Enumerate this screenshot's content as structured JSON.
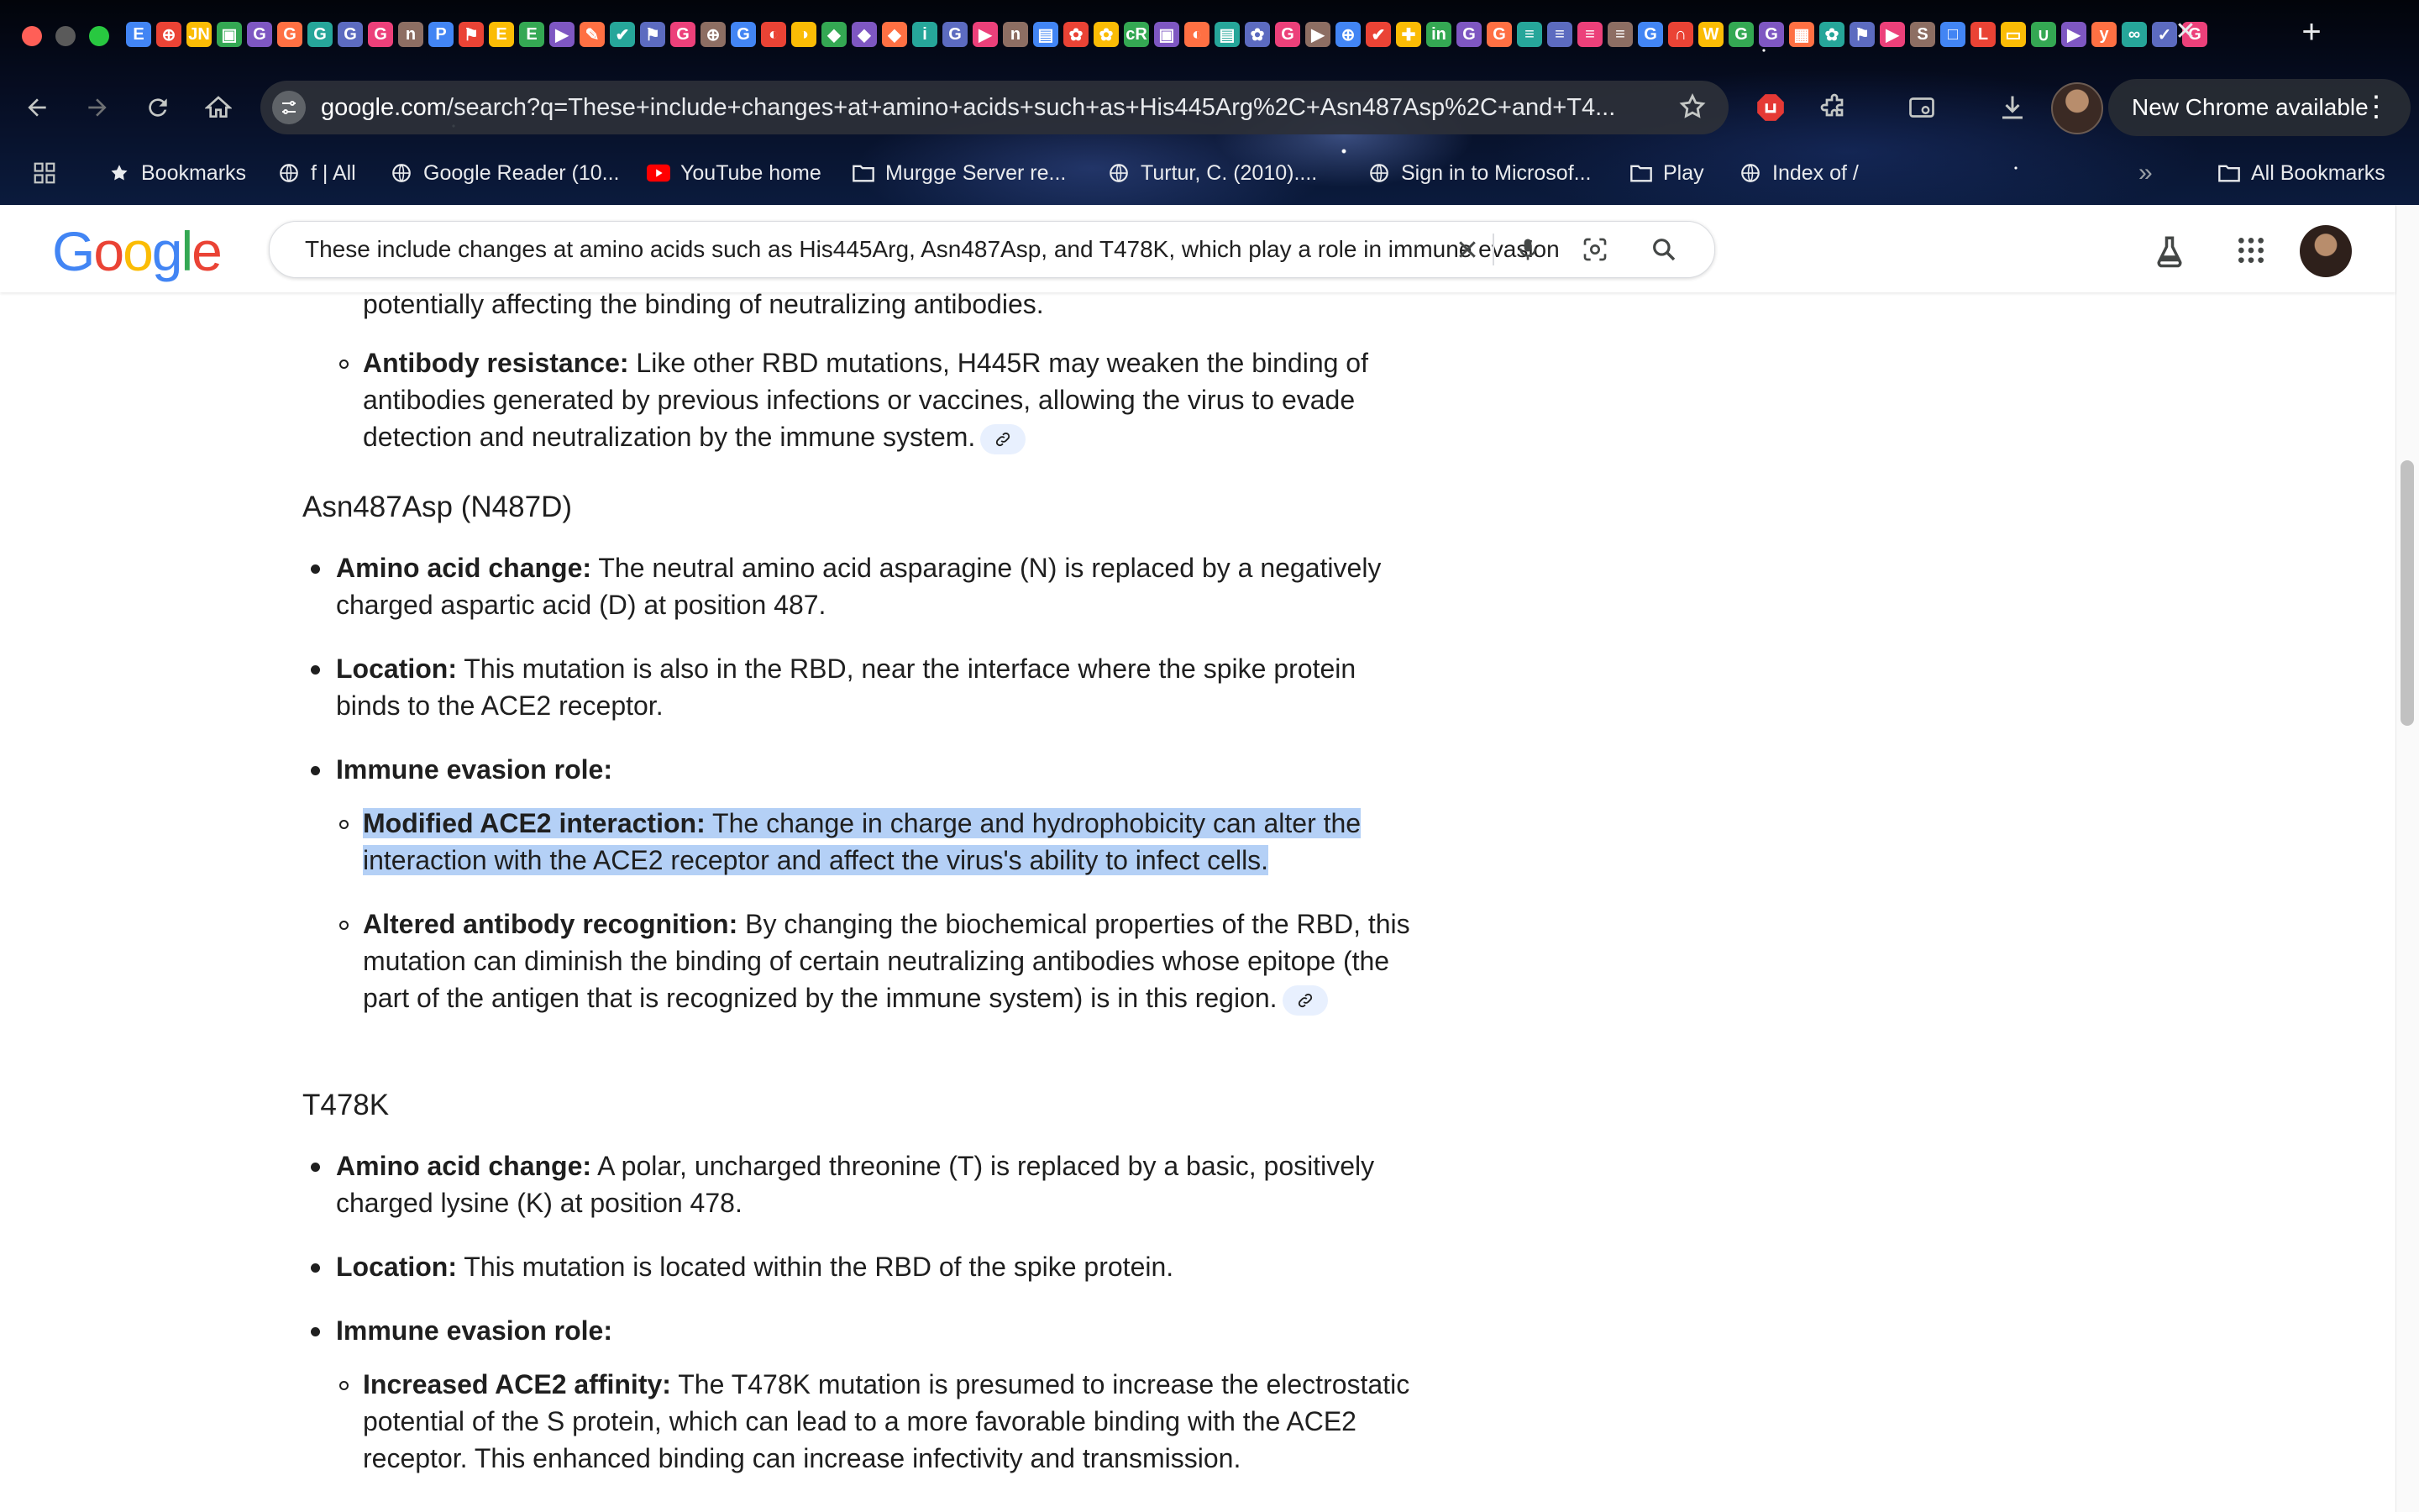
{
  "browser": {
    "url_domain": "google.com",
    "url_rest": "/search?q=These+include+changes+at+amino+acids+such+as+His445Arg%2C+Asn487Asp%2C+and+T4...",
    "update_label": "New Chrome available",
    "tab_favicons": [
      "E",
      "⊕",
      "JN",
      "▣",
      "G",
      "G",
      "G",
      "G",
      "G",
      "n",
      "P",
      "⚑",
      "E",
      "E",
      "▶",
      "✎",
      "✔",
      "⚑",
      "G",
      "⊕",
      "G",
      "◐",
      "◑",
      "◆",
      "◆",
      "◆",
      "i",
      "G",
      "▶",
      "n",
      "▤",
      "✿",
      "✿",
      "cR",
      "▣",
      "◐",
      "▤",
      "✿",
      "G",
      "▶",
      "⊕",
      "✔",
      "✚",
      "in",
      "G",
      "G",
      "≡",
      "≡",
      "≡",
      "≡",
      "G",
      "∩",
      "W",
      "G",
      "G",
      "▦",
      "✿",
      "⚑",
      "▶",
      "S",
      "□",
      "L",
      "▭",
      "∪",
      "▶",
      "y",
      "∞",
      "✓",
      "G"
    ],
    "colors": {
      "accent_red": "#ea4335",
      "accent_blue": "#4285f4",
      "accent_yellow": "#fbbc05",
      "accent_green": "#34a853"
    }
  },
  "bookmarks": {
    "items": [
      {
        "label": "Bookmarks",
        "icon": "star-icon"
      },
      {
        "label": "f | All",
        "icon": "globe-icon"
      },
      {
        "label": "Google Reader (10...",
        "icon": "globe-icon"
      },
      {
        "label": "YouTube home",
        "icon": "youtube-icon"
      },
      {
        "label": "Murgge Server re...",
        "icon": "folder-icon"
      },
      {
        "label": "Turtur, C. (2010)....",
        "icon": "globe-icon"
      },
      {
        "label": "Sign in to Microsof...",
        "icon": "globe-icon"
      },
      {
        "label": "Play",
        "icon": "folder-icon"
      },
      {
        "label": "Index of /",
        "icon": "globe-icon"
      }
    ],
    "all_label": "All Bookmarks"
  },
  "google": {
    "logo_letters": [
      "G",
      "o",
      "o",
      "g",
      "l",
      "e"
    ],
    "search_value": "These include changes at amino acids such as His445Arg, Asn487Asp, and T478K, which play a role in immune evasion"
  },
  "content": {
    "top_fragment": "potentially affecting the binding of neutralizing antibodies.",
    "h445r_resistance_label": "Antibody resistance:",
    "h445r_resistance_text": " Like other RBD mutations, H445R may weaken the binding of antibodies generated by previous infections or vaccines, allowing the virus to evade detection and neutralization by the immune system.",
    "sections": [
      {
        "title": "Asn487Asp (N487D)",
        "aa_label": "Amino acid change:",
        "aa_text": " The neutral amino acid asparagine (N) is replaced by a negatively charged aspartic acid (D) at position 487.",
        "loc_label": "Location:",
        "loc_text": " This mutation is also in the RBD, near the interface where the spike protein binds to the ACE2 receptor.",
        "role_label": "Immune evasion role:",
        "sub1_label": "Modified ACE2 interaction:",
        "sub1_text": " The change in charge and hydrophobicity can alter the interaction with the ACE2 receptor and affect the virus's ability to infect cells.",
        "sub2_label": "Altered antibody recognition:",
        "sub2_text": " By changing the biochemical properties of the RBD, this mutation can diminish the binding of certain neutralizing antibodies whose epitope (the part of the antigen that is recognized by the immune system) is in this region."
      },
      {
        "title": "T478K",
        "aa_label": "Amino acid change:",
        "aa_text": " A polar, uncharged threonine (T) is replaced by a basic, positively charged lysine (K) at position 478.",
        "loc_label": "Location:",
        "loc_text": " This mutation is located within the RBD of the spike protein.",
        "role_label": "Immune evasion role:",
        "sub1_label": "Increased ACE2 affinity:",
        "sub1_text": " The T478K mutation is presumed to increase the electrostatic potential of the S protein, which can lead to a more favorable binding with the ACE2 receptor. This enhanced binding can increase infectivity and transmission."
      }
    ]
  }
}
